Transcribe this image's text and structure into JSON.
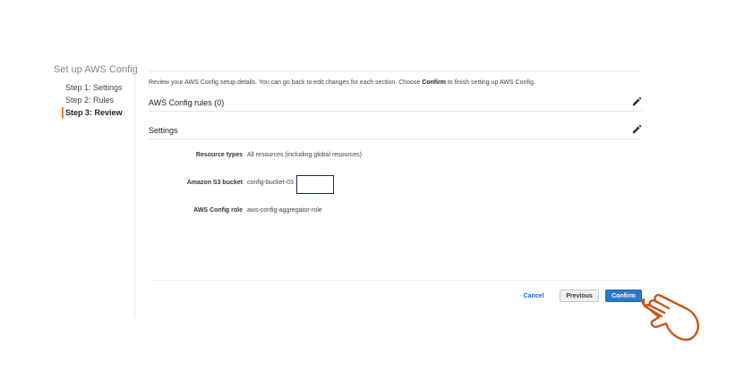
{
  "sidebar": {
    "title": "Set up AWS Config",
    "steps": [
      {
        "label": "Step 1: Settings"
      },
      {
        "label": "Step 2: Rules"
      },
      {
        "label": "Step 3: Review"
      }
    ]
  },
  "main": {
    "intro_before": "Review your AWS Config setup details. You can go back to edit changes for each section. Choose ",
    "intro_bold": "Confirm",
    "intro_after": " to finish setting up AWS Config.",
    "rules_section": {
      "title": "AWS Config rules (0)",
      "edit_icon": "pencil-icon"
    },
    "settings_section": {
      "title": "Settings",
      "edit_icon": "pencil-icon"
    },
    "settings": {
      "resource_types": {
        "label": "Resource types",
        "value": "All resources (including global resources)"
      },
      "s3_bucket": {
        "label": "Amazon S3 bucket",
        "value": "config-bucket-03"
      },
      "config_role": {
        "label": "AWS Config role",
        "value": "aws-config-aggregator-role"
      }
    }
  },
  "footer": {
    "cancel_label": "Cancel",
    "previous_label": "Previous",
    "confirm_label": "Confirm"
  },
  "overlay": {
    "icon": "pointing-hand-icon",
    "color": "#c9561f"
  },
  "colors": {
    "primary": "#2b78d0",
    "active_step_marker": "#e8830c",
    "link": "#1166bb"
  }
}
